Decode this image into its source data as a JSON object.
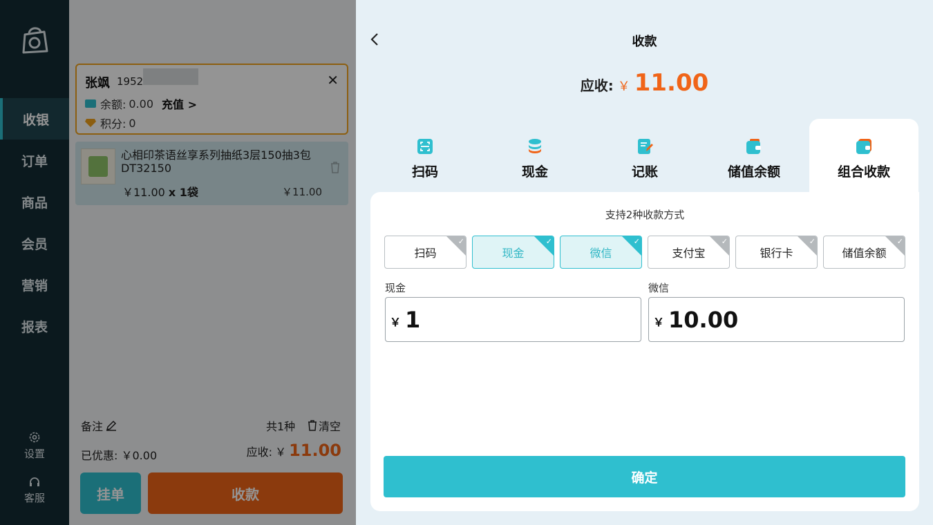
{
  "sidebar": {
    "items": [
      {
        "label": "收银",
        "active": true
      },
      {
        "label": "订单"
      },
      {
        "label": "商品"
      },
      {
        "label": "会员"
      },
      {
        "label": "营销"
      },
      {
        "label": "报表"
      }
    ],
    "settings_label": "设置",
    "support_label": "客服"
  },
  "member": {
    "name": "张飒",
    "phone_prefix": "1952",
    "balance_label": "余额:",
    "balance_value": "0.00",
    "recharge_label": "充值 >",
    "points_label": "积分:",
    "points_value": "0"
  },
  "cart": {
    "items": [
      {
        "name": "心相印茶语丝享系列抽纸3层150抽3包DT32150",
        "unit_price": "￥11.00",
        "qty": "x 1袋",
        "total": "￥11.00"
      }
    ],
    "remark_label": "备注",
    "count_label": "共1种",
    "clear_label": "清空",
    "discount_label": "已优惠:",
    "discount_value": "￥0.00",
    "due_label": "应收:",
    "due_currency": "￥",
    "due_value": "11.00",
    "hold_label": "挂单",
    "pay_label": "收款"
  },
  "payment": {
    "title": "收款",
    "receivable_label": "应收:",
    "currency": "￥",
    "receivable_value": "11.00",
    "tabs": [
      {
        "label": "扫码",
        "icon": "scan-icon"
      },
      {
        "label": "现金",
        "icon": "coins-icon"
      },
      {
        "label": "记账",
        "icon": "ledger-icon"
      },
      {
        "label": "储值余额",
        "icon": "wallet-icon"
      },
      {
        "label": "组合收款",
        "icon": "combo-wallet-icon",
        "active": true
      }
    ],
    "support_text": "支持2种收款方式",
    "methods": [
      {
        "label": "扫码",
        "selected": false
      },
      {
        "label": "现金",
        "selected": true
      },
      {
        "label": "微信",
        "selected": true
      },
      {
        "label": "支付宝",
        "selected": false
      },
      {
        "label": "银行卡",
        "selected": false
      },
      {
        "label": "储值余额",
        "selected": false
      }
    ],
    "fields": [
      {
        "label": "现金",
        "symbol": "￥",
        "value": "1"
      },
      {
        "label": "微信",
        "symbol": "￥",
        "value": "10.00"
      }
    ],
    "confirm_label": "确定",
    "colors": {
      "accent": "#2fbfcf",
      "orange": "#f06418"
    }
  }
}
